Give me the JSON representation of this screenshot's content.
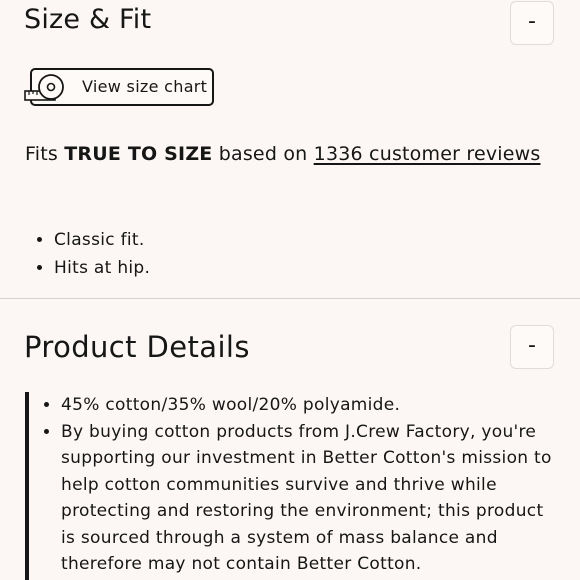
{
  "size_fit": {
    "title": "Size & Fit",
    "toggle_label": "-",
    "size_chart_label": "View size chart",
    "fit_prefix": "Fits",
    "fit_value": "TRUE TO SIZE",
    "fit_middle": "based on",
    "reviews_link": "1336 customer reviews",
    "bullets": [
      "Classic fit.",
      "Hits at hip."
    ]
  },
  "product_details": {
    "title": "Product Details",
    "toggle_label": "-",
    "bullets": [
      "45% cotton/35% wool/20% polyamide.",
      "By buying cotton products from J.Crew Factory, you're supporting our investment in Better Cotton's mission to help cotton communities survive and thrive while protecting and restoring the environment; this product is sourced through a system of mass balance and therefore may not contain Better Cotton."
    ]
  },
  "icons": {
    "size_chart": "measuring-tape-icon"
  }
}
